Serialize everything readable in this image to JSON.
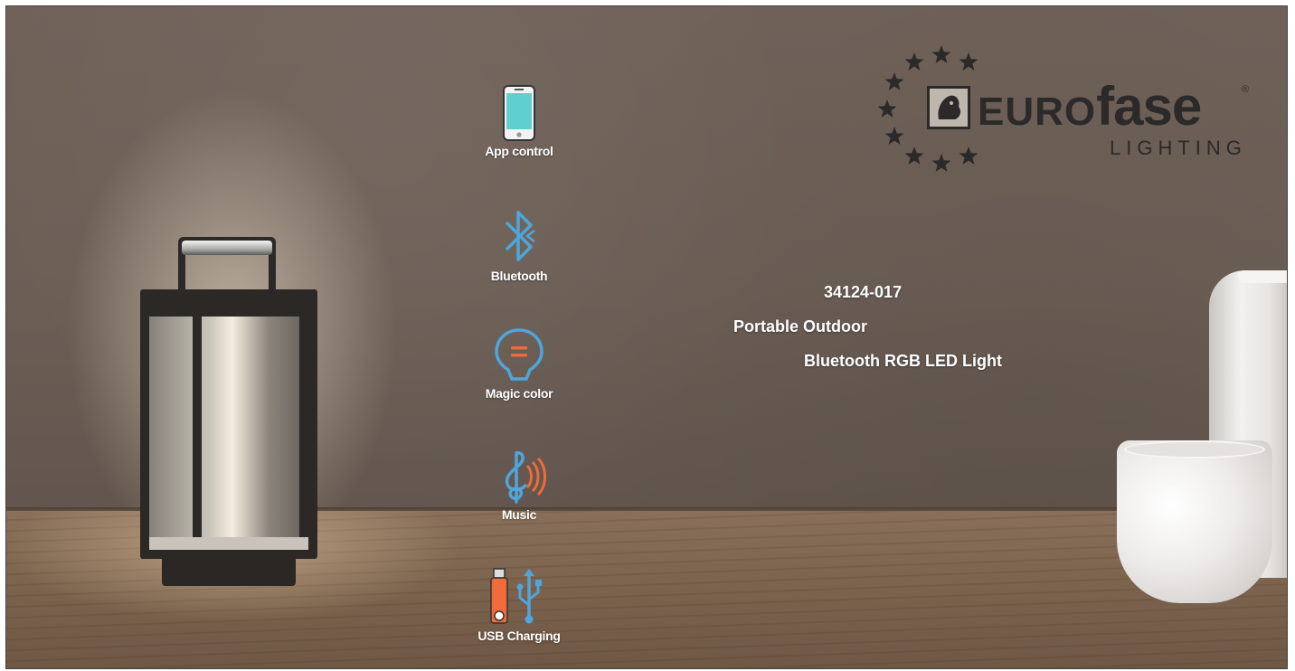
{
  "brand": {
    "name_part1": "EURO",
    "name_part2": "fase",
    "registered": "®",
    "subtitle": "LIGHTING"
  },
  "features": [
    {
      "label": "App control",
      "icon": "smartphone-icon"
    },
    {
      "label": "Bluetooth",
      "icon": "bluetooth-icon"
    },
    {
      "label": "Magic color",
      "icon": "color-bulb-icon"
    },
    {
      "label": "Music",
      "icon": "music-note-icon"
    },
    {
      "label": "USB Charging",
      "icon": "usb-icon"
    }
  ],
  "product": {
    "model": "34124-017",
    "line1": "Portable Outdoor",
    "line2": "Bluetooth RGB LED Light"
  },
  "colors": {
    "icon_blue": "#4ea6dc",
    "icon_orange": "#ef6b3a",
    "logo_dark": "#2b2a28"
  }
}
